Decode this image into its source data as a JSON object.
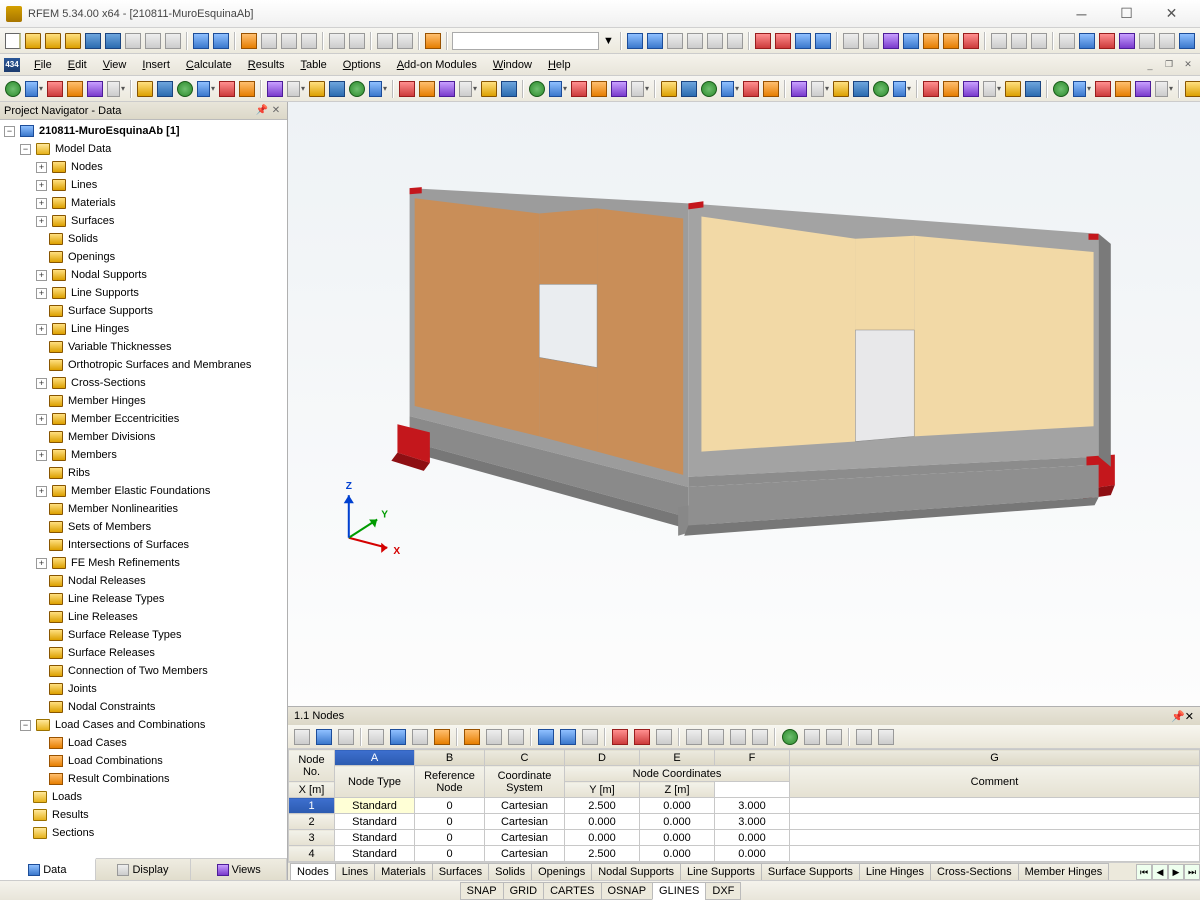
{
  "title": "RFEM 5.34.00 x64 - [210811-MuroEsquinaAb]",
  "menu": [
    "File",
    "Edit",
    "View",
    "Insert",
    "Calculate",
    "Results",
    "Table",
    "Options",
    "Add-on Modules",
    "Window",
    "Help"
  ],
  "navigator": {
    "title": "Project Navigator - Data",
    "root": "210811-MuroEsquinaAb [1]",
    "modelData": "Model Data",
    "items": [
      "Nodes",
      "Lines",
      "Materials",
      "Surfaces",
      "Solids",
      "Openings",
      "Nodal Supports",
      "Line Supports",
      "Surface Supports",
      "Line Hinges",
      "Variable Thicknesses",
      "Orthotropic Surfaces and Membranes",
      "Cross-Sections",
      "Member Hinges",
      "Member Eccentricities",
      "Member Divisions",
      "Members",
      "Ribs",
      "Member Elastic Foundations",
      "Member Nonlinearities",
      "Sets of Members",
      "Intersections of Surfaces",
      "FE Mesh Refinements",
      "Nodal Releases",
      "Line Release Types",
      "Line Releases",
      "Surface Release Types",
      "Surface Releases",
      "Connection of Two Members",
      "Joints",
      "Nodal Constraints"
    ],
    "expandable": [
      0,
      1,
      2,
      3,
      6,
      7,
      9,
      12,
      14,
      16,
      18,
      22
    ],
    "loadCases": "Load Cases and Combinations",
    "loadSub": [
      "Load Cases",
      "Load Combinations",
      "Result Combinations"
    ],
    "extra": [
      "Loads",
      "Results",
      "Sections"
    ],
    "tabs": [
      "Data",
      "Display",
      "Views"
    ]
  },
  "tablePanel": {
    "title": "1.1 Nodes",
    "letters": [
      "A",
      "B",
      "C",
      "D",
      "E",
      "F",
      "G"
    ],
    "group": "Node Coordinates",
    "heads": [
      "Node\nNo.",
      "Node Type",
      "Reference\nNode",
      "Coordinate\nSystem",
      "X [m]",
      "Y [m]",
      "Z [m]",
      "Comment"
    ],
    "rows": [
      {
        "no": 1,
        "type": "Standard",
        "ref": "0",
        "sys": "Cartesian",
        "x": "2.500",
        "y": "0.000",
        "z": "3.000",
        "c": ""
      },
      {
        "no": 2,
        "type": "Standard",
        "ref": "0",
        "sys": "Cartesian",
        "x": "0.000",
        "y": "0.000",
        "z": "3.000",
        "c": ""
      },
      {
        "no": 3,
        "type": "Standard",
        "ref": "0",
        "sys": "Cartesian",
        "x": "0.000",
        "y": "0.000",
        "z": "0.000",
        "c": ""
      },
      {
        "no": 4,
        "type": "Standard",
        "ref": "0",
        "sys": "Cartesian",
        "x": "2.500",
        "y": "0.000",
        "z": "0.000",
        "c": ""
      }
    ],
    "sheets": [
      "Nodes",
      "Lines",
      "Materials",
      "Surfaces",
      "Solids",
      "Openings",
      "Nodal Supports",
      "Line Supports",
      "Surface Supports",
      "Line Hinges",
      "Cross-Sections",
      "Member Hinges"
    ]
  },
  "status": [
    "SNAP",
    "GRID",
    "CARTES",
    "OSNAP",
    "GLINES",
    "DXF"
  ],
  "axes": {
    "x": "X",
    "y": "Y",
    "z": "Z"
  }
}
